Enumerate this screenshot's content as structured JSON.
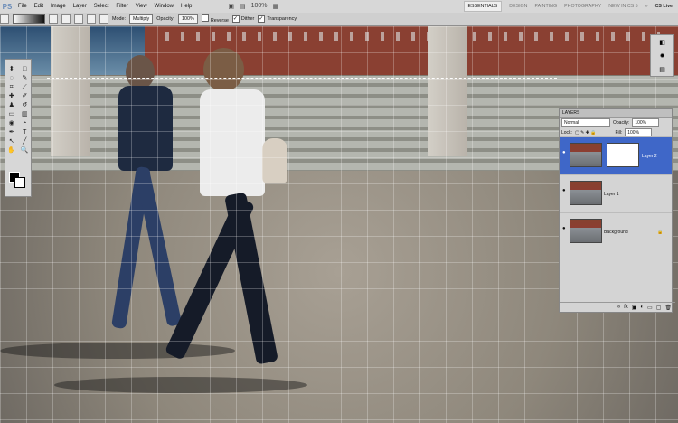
{
  "menu": {
    "logo": "PS",
    "items": [
      "File",
      "Edit",
      "Image",
      "Layer",
      "Select",
      "Filter",
      "View",
      "Window",
      "Help"
    ],
    "zoom": "100%",
    "workspaces": [
      "ESSENTIALS",
      "DESIGN",
      "PAINTING",
      "PHOTOGRAPHY",
      "NEW IN CS 5"
    ],
    "more": "»",
    "cslive": "CS Live"
  },
  "options": {
    "mode_label": "Mode:",
    "mode_value": "Multiply",
    "opacity_label": "Opacity:",
    "opacity_value": "100%",
    "reverse": "Reverse",
    "dither": "Dither",
    "transparency": "Transparency"
  },
  "toolbox": {
    "tools": [
      "move",
      "marquee",
      "lasso",
      "crop",
      "eyedropper",
      "heal",
      "brush",
      "stamp",
      "history",
      "eraser",
      "gradient",
      "blur",
      "dodge",
      "pen",
      "type",
      "path",
      "shape",
      "hand",
      "zoom",
      "swap"
    ]
  },
  "layers": {
    "tab": "LAYERS",
    "blend": "Normal",
    "opacity_label": "Opacity:",
    "opacity_value": "100%",
    "lock_label": "Lock:",
    "fill_label": "Fill:",
    "fill_value": "100%",
    "items": [
      {
        "name": "Layer 2"
      },
      {
        "name": "Layer 1"
      },
      {
        "name": "Background"
      }
    ]
  },
  "icons": {
    "eye": "eye-icon",
    "lock": "lock-icon",
    "search": "zoom-icon"
  }
}
